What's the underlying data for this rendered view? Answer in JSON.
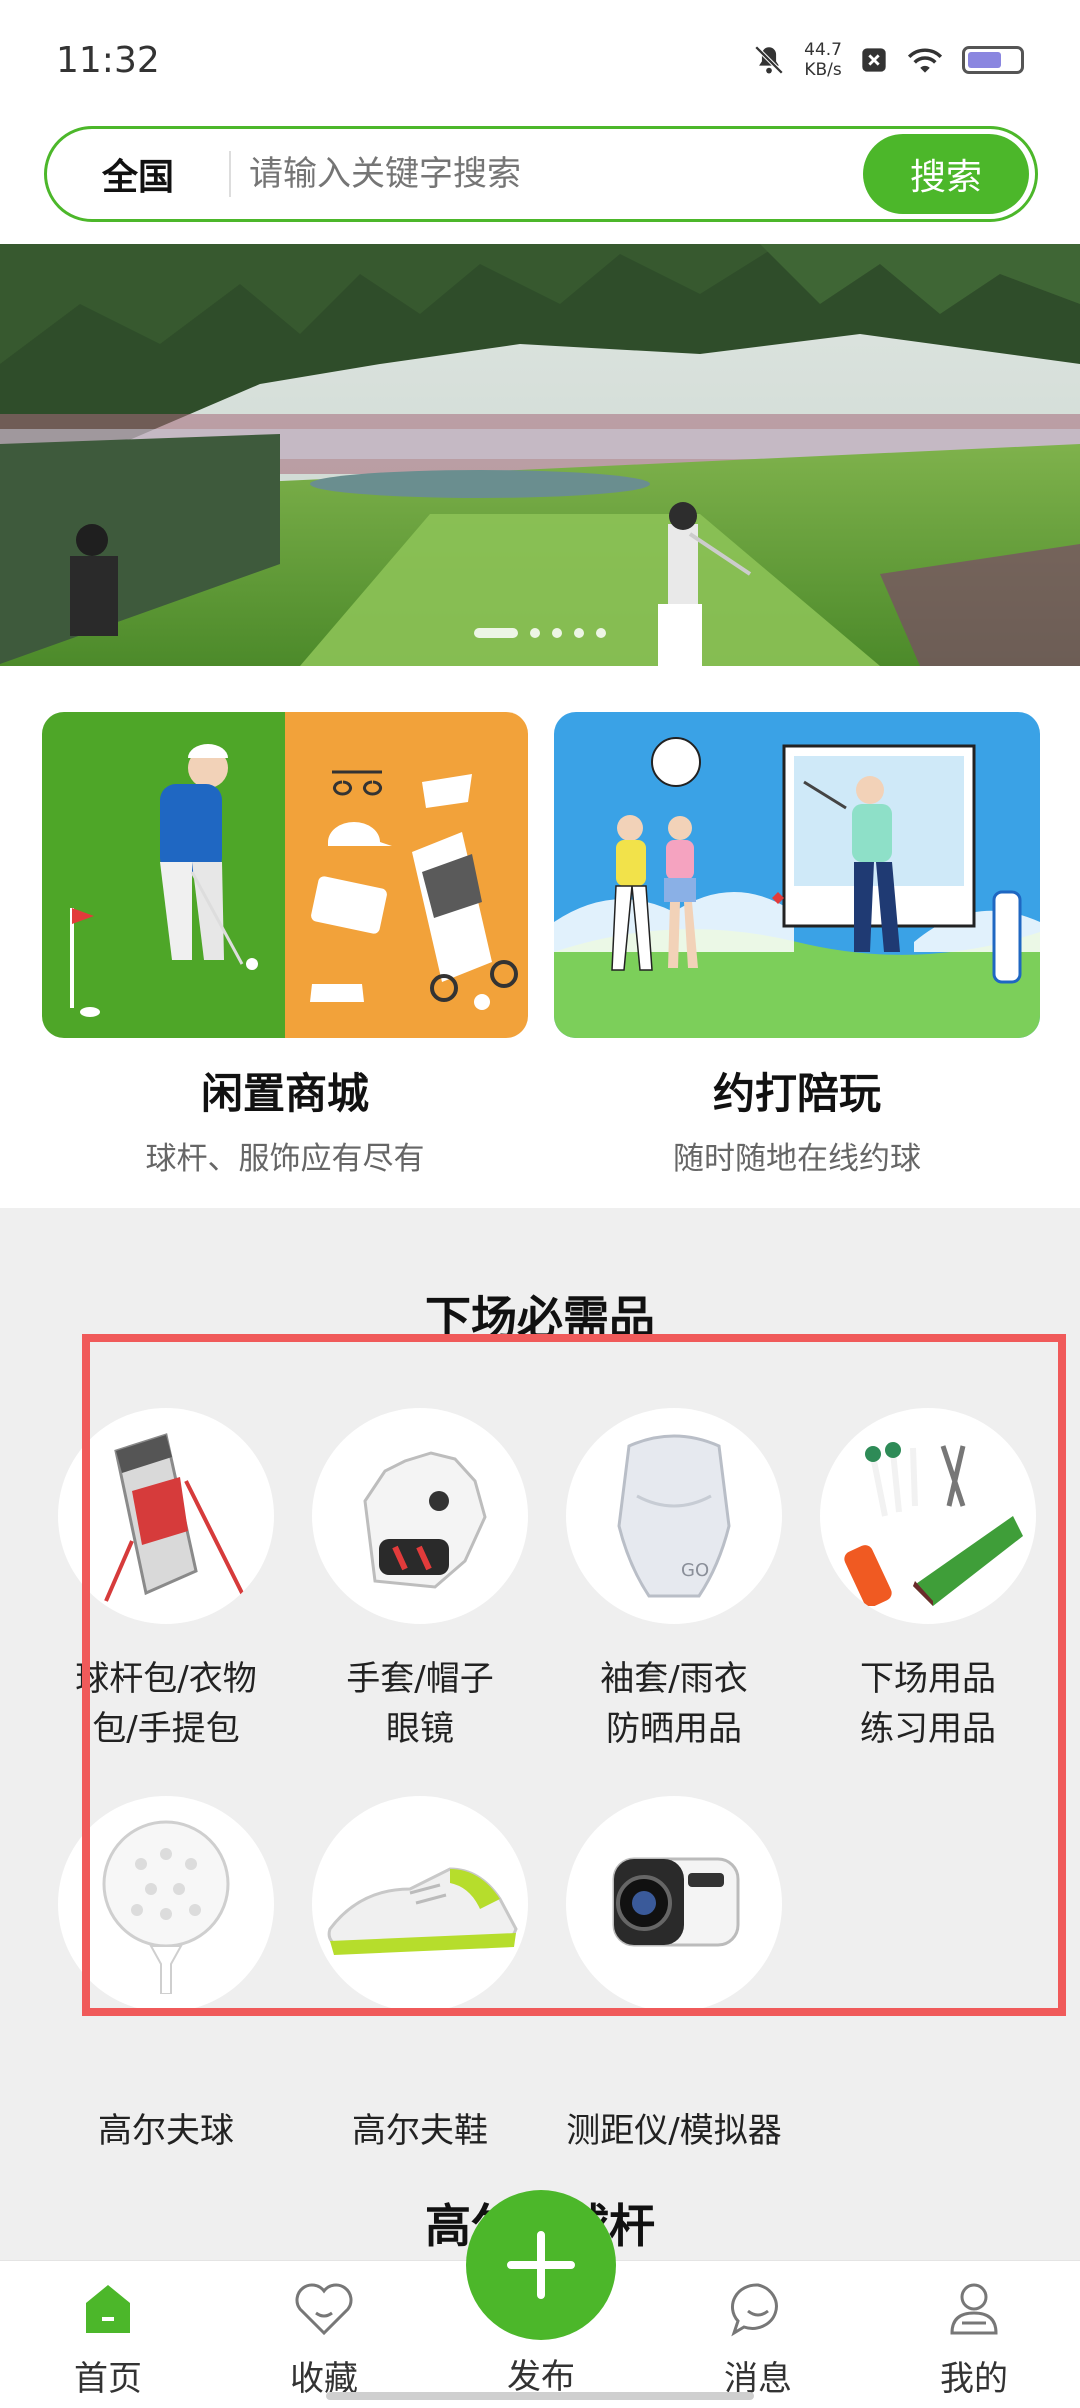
{
  "status_bar": {
    "time": "11:32",
    "speed_value": "44.7",
    "speed_unit": "KB/s",
    "battery_level_percent": 65
  },
  "search": {
    "region": "全国",
    "placeholder": "请输入关键字搜索",
    "button": "搜索"
  },
  "banner": {
    "slide_count": 5,
    "active_index": 0
  },
  "cards": [
    {
      "title": "闲置商城",
      "subtitle": "球杆、服饰应有尽有"
    },
    {
      "title": "约打陪玩",
      "subtitle": "随时随地在线约球"
    }
  ],
  "sections": {
    "essentials_title": "下场必需品",
    "clubs_title": "高尔夫球杆"
  },
  "categories": [
    {
      "label": "球杆包/衣物\n包/手提包",
      "icon": "golf-bag-icon"
    },
    {
      "label": "手套/帽子\n眼镜",
      "icon": "glove-icon"
    },
    {
      "label": "袖套/雨衣\n防晒用品",
      "icon": "sleeve-icon"
    },
    {
      "label": "下场用品\n练习用品",
      "icon": "accessories-icon"
    },
    {
      "label": "高尔夫球",
      "icon": "golf-ball-icon"
    },
    {
      "label": "高尔夫鞋",
      "icon": "golf-shoe-icon"
    },
    {
      "label": "测距仪/模拟器",
      "icon": "rangefinder-icon"
    }
  ],
  "bottom_nav": [
    {
      "label": "首页",
      "icon": "home-icon",
      "active": true
    },
    {
      "label": "收藏",
      "icon": "heart-icon",
      "active": false
    },
    {
      "label": "发布",
      "icon": "plus-icon",
      "active": false
    },
    {
      "label": "消息",
      "icon": "message-icon",
      "active": false
    },
    {
      "label": "我的",
      "icon": "user-icon",
      "active": false
    }
  ],
  "colors": {
    "brand": "#4cb72a",
    "highlight": "#f05a5a",
    "section_bg": "#efefef"
  }
}
